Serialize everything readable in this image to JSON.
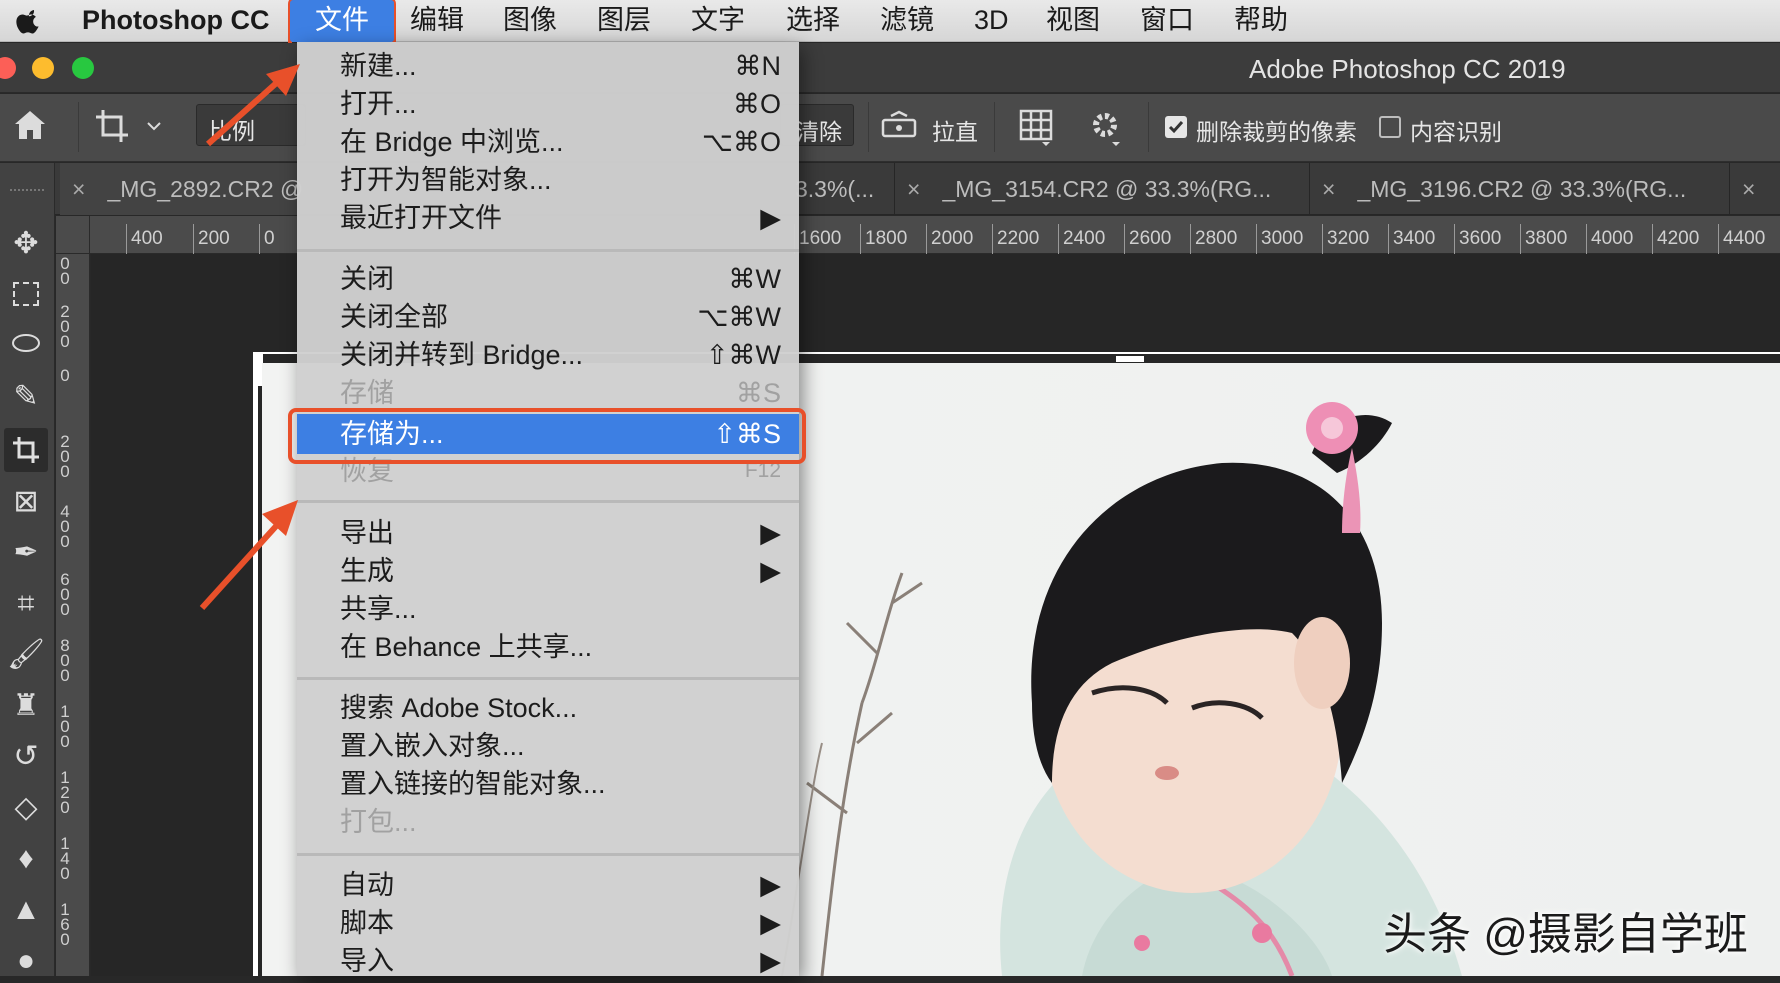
{
  "menubar": {
    "app_name": "Photoshop CC",
    "items": [
      "文件",
      "编辑",
      "图像",
      "图层",
      "文字",
      "选择",
      "滤镜",
      "3D",
      "视图",
      "窗口",
      "帮助"
    ]
  },
  "window": {
    "title": "Adobe Photoshop CC 2019"
  },
  "options_bar": {
    "ratio_label": "比例",
    "clear_label": "清除",
    "straighten_label": "拉直",
    "delete_cropped_label": "删除裁剪的像素",
    "delete_cropped_checked": true,
    "content_aware_label": "内容识别",
    "content_aware_checked": false
  },
  "tabs": [
    {
      "label": "_MG_2892.CR2 @"
    },
    {
      "label": "3.3%(..."
    },
    {
      "label": "_MG_3154.CR2 @ 33.3%(RG..."
    },
    {
      "label": "_MG_3196.CR2 @ 33.3%(RG..."
    },
    {
      "label": ""
    }
  ],
  "tab_close": "×",
  "ruler_top": [
    "400",
    "200",
    "0",
    "1600",
    "1800",
    "2000",
    "2200",
    "2400",
    "2600",
    "2800",
    "3000",
    "3200",
    "3400",
    "3600",
    "3800",
    "4000",
    "4200",
    "4400"
  ],
  "ruler_left": [
    "0\n0",
    "2\n0\n0",
    "0",
    "2\n0\n0",
    "4\n0\n0",
    "6\n0\n0",
    "8\n0\n0",
    "1\n0\n0",
    "1\n2\n0",
    "1\n4\n0",
    "1\n6\n0"
  ],
  "file_menu": {
    "groups": [
      [
        {
          "label": "新建...",
          "shortcut": "⌘N"
        },
        {
          "label": "打开...",
          "shortcut": "⌘O"
        },
        {
          "label": "在 Bridge 中浏览...",
          "shortcut": "⌥⌘O"
        },
        {
          "label": "打开为智能对象...",
          "shortcut": ""
        },
        {
          "label": "最近打开文件",
          "shortcut": "▶"
        }
      ],
      [
        {
          "label": "关闭",
          "shortcut": "⌘W"
        },
        {
          "label": "关闭全部",
          "shortcut": "⌥⌘W"
        },
        {
          "label": "关闭并转到 Bridge...",
          "shortcut": "⇧⌘W"
        },
        {
          "label": "存储",
          "shortcut": "⌘S",
          "disabled": true
        },
        {
          "label": "存储为...",
          "shortcut": "⇧⌘S",
          "selected": true
        },
        {
          "label": "恢复",
          "shortcut": "F12",
          "disabled": true
        }
      ],
      [
        {
          "label": "导出",
          "shortcut": "▶"
        },
        {
          "label": "生成",
          "shortcut": "▶"
        },
        {
          "label": "共享...",
          "shortcut": ""
        },
        {
          "label": "在 Behance 上共享...",
          "shortcut": ""
        }
      ],
      [
        {
          "label": "搜索 Adobe Stock...",
          "shortcut": ""
        },
        {
          "label": "置入嵌入对象...",
          "shortcut": ""
        },
        {
          "label": "置入链接的智能对象...",
          "shortcut": ""
        },
        {
          "label": "打包...",
          "shortcut": "",
          "disabled": true
        }
      ],
      [
        {
          "label": "自动",
          "shortcut": "▶"
        },
        {
          "label": "脚本",
          "shortcut": "▶"
        },
        {
          "label": "导入",
          "shortcut": "▶"
        }
      ]
    ]
  },
  "watermark": "头条 @摄影自学班",
  "colors": {
    "accent": "#3d7fe3",
    "annotation": "#e8502a"
  }
}
